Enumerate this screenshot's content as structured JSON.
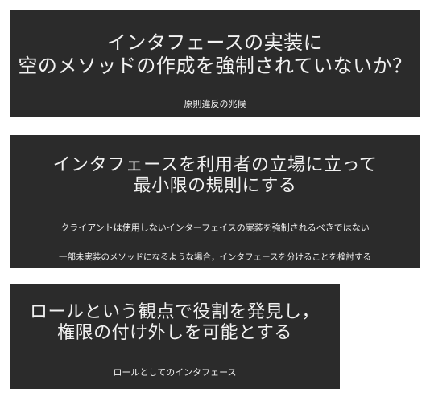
{
  "slides": [
    {
      "title_lines": [
        "インタフェースの実装に",
        "空のメソッドの作成を強制されていないか？"
      ],
      "subtitle": "原則違反の兆候"
    },
    {
      "title_lines": [
        "インタフェースを利用者の立場に立って",
        "最小限の規則にする"
      ],
      "sub_lines": [
        "クライアントは使用しないインターフェイスの実装を強制されるべきではない",
        "一部未実装のメソッドになるような場合，インタフェースを分けることを検討する"
      ]
    },
    {
      "title_lines": [
        "ロールという観点で役割を発見し，",
        "権限の付け外しを可能とする"
      ],
      "subtitle": "ロールとしてのインタフェース"
    }
  ],
  "colors": {
    "slide_background": "#2b2b2b",
    "text": "#f2f2f2",
    "page_background": "#ffffff"
  }
}
